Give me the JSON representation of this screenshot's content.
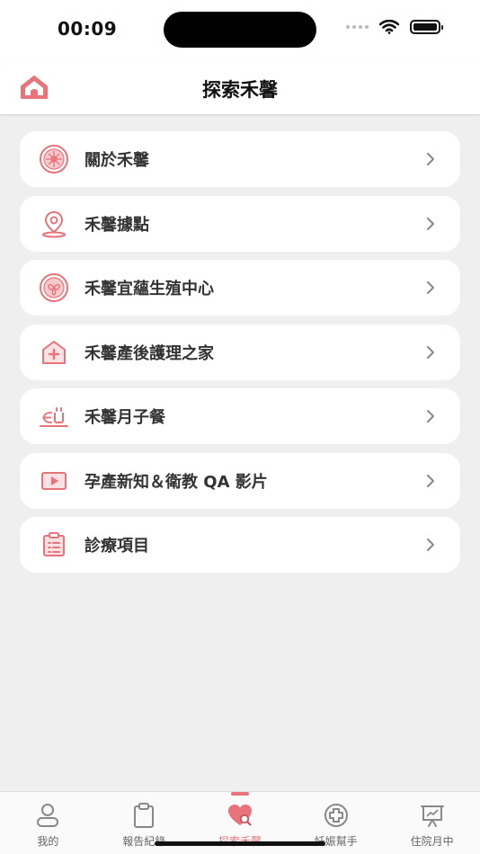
{
  "status_bar": {
    "time": "00:09"
  },
  "header": {
    "title": "探索禾馨"
  },
  "menu": [
    {
      "label": "關於禾馨",
      "icon": "clinic-emblem-icon"
    },
    {
      "label": "禾馨據點",
      "icon": "location-pin-icon"
    },
    {
      "label": "禾馨宜蘊生殖中心",
      "icon": "fertility-emblem-icon"
    },
    {
      "label": "禾馨產後護理之家",
      "icon": "medical-house-icon"
    },
    {
      "label": "禾馨月子餐",
      "icon": "meal-icon"
    },
    {
      "label": "孕產新知＆衛教 QA 影片",
      "icon": "video-play-icon"
    },
    {
      "label": "診療項目",
      "icon": "clipboard-list-icon"
    }
  ],
  "tabs": [
    {
      "label": "我的",
      "icon": "person-icon",
      "active": false
    },
    {
      "label": "報告紀錄",
      "icon": "clipboard-icon",
      "active": false
    },
    {
      "label": "探索禾馨",
      "icon": "heart-search-icon",
      "active": true
    },
    {
      "label": "妊娠幫手",
      "icon": "medical-cross-icon",
      "active": false
    },
    {
      "label": "住院月中",
      "icon": "presentation-icon",
      "active": false
    }
  ],
  "colors": {
    "accent": "#e8737a",
    "icon_gray": "#8a8a8a",
    "background": "#efefef"
  }
}
